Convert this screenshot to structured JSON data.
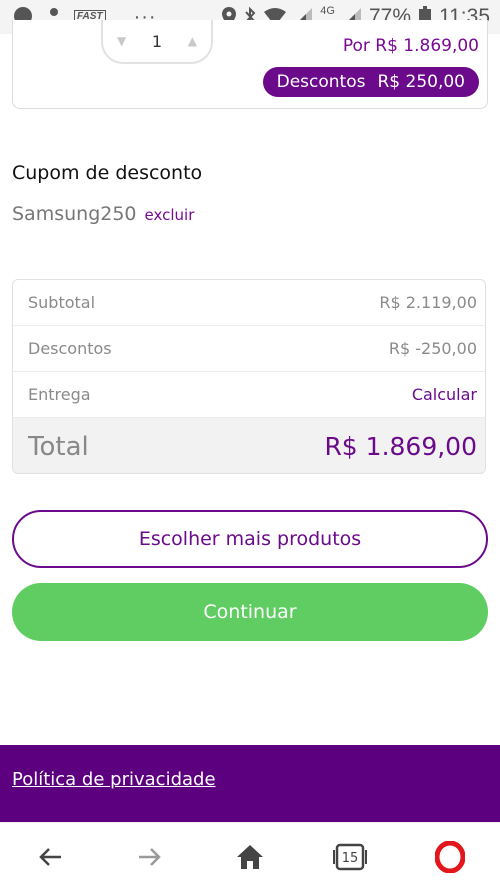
{
  "status_bar": {
    "fast_label": "FAST",
    "dots": "···",
    "network": "4G",
    "battery": "77%",
    "time": "11:35"
  },
  "product_card": {
    "quantity": "1",
    "price_text": "Por R$ 1.869,00",
    "discount_label": "Descontos",
    "discount_value": "R$ 250,00"
  },
  "coupon": {
    "title": "Cupom de desconto",
    "code": "Samsung250",
    "remove_label": "excluir"
  },
  "summary": {
    "subtotal_label": "Subtotal",
    "subtotal_value": "R$ 2.119,00",
    "discounts_label": "Descontos",
    "discounts_value": "R$ -250,00",
    "delivery_label": "Entrega",
    "delivery_action": "Calcular",
    "total_label": "Total",
    "total_value": "R$ 1.869,00"
  },
  "actions": {
    "more_products": "Escolher mais produtos",
    "continue": "Continuar"
  },
  "footer": {
    "privacy_link": "Política de privacidade"
  },
  "browser_nav": {
    "tabs_count": "15"
  },
  "colors": {
    "brand_purple": "#6b0a8a",
    "footer_purple": "#5c0080",
    "continue_green": "#5fcd62",
    "opera_red": "#e3161c"
  }
}
